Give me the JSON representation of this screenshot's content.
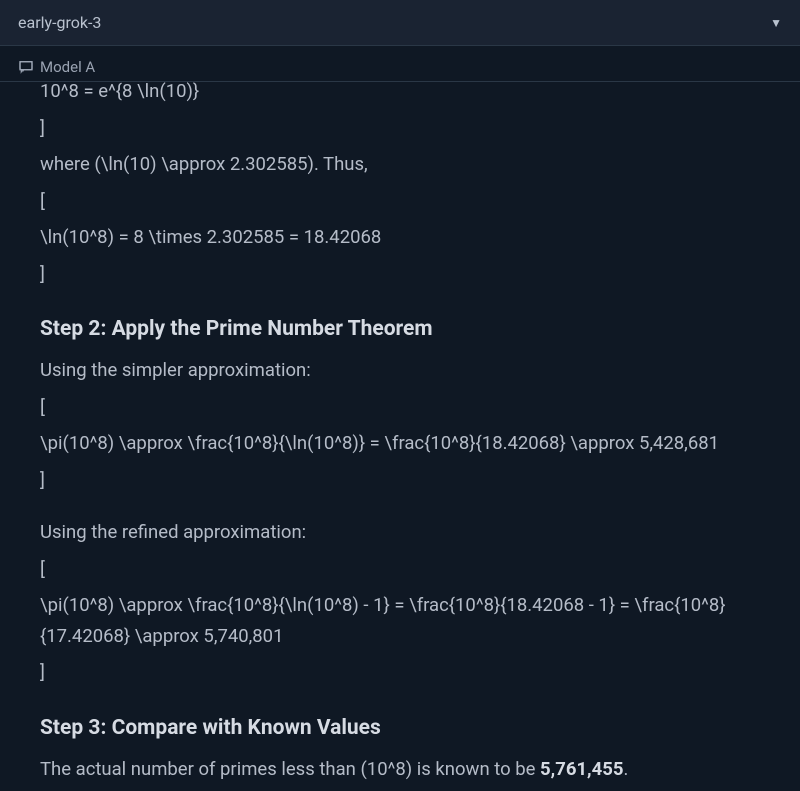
{
  "header": {
    "title": "early-grok-3"
  },
  "tab": {
    "label": "Model A"
  },
  "body": {
    "line1": "10^8 = e^{8 \\ln(10)}",
    "line2": "]",
    "line3": "where (\\ln(10) \\approx 2.302585). Thus,",
    "line4": "[",
    "line5": "\\ln(10^8) = 8 \\times 2.302585 = 18.42068",
    "line6": "]",
    "step2_heading": "Step 2: Apply the Prime Number Theorem",
    "step2_intro": "Using the simpler approximation:",
    "step2_b1": "[",
    "step2_b2": "\\pi(10^8) \\approx \\frac{10^8}{\\ln(10^8)} = \\frac{10^8}{18.42068} \\approx 5,428,681",
    "step2_b3": "]",
    "step2_intro2": "Using the refined approximation:",
    "step2_c1": "[",
    "step2_c2": "\\pi(10^8) \\approx \\frac{10^8}{\\ln(10^8) - 1} = \\frac{10^8}{18.42068 - 1} = \\frac{10^8}{17.42068} \\approx 5,740,801",
    "step2_c3": "]",
    "step3_heading": "Step 3: Compare with Known Values",
    "step3_text_pre": "The actual number of primes less than (10^8) is known to be ",
    "step3_text_bold": "5,761,455",
    "step3_text_post": "."
  }
}
